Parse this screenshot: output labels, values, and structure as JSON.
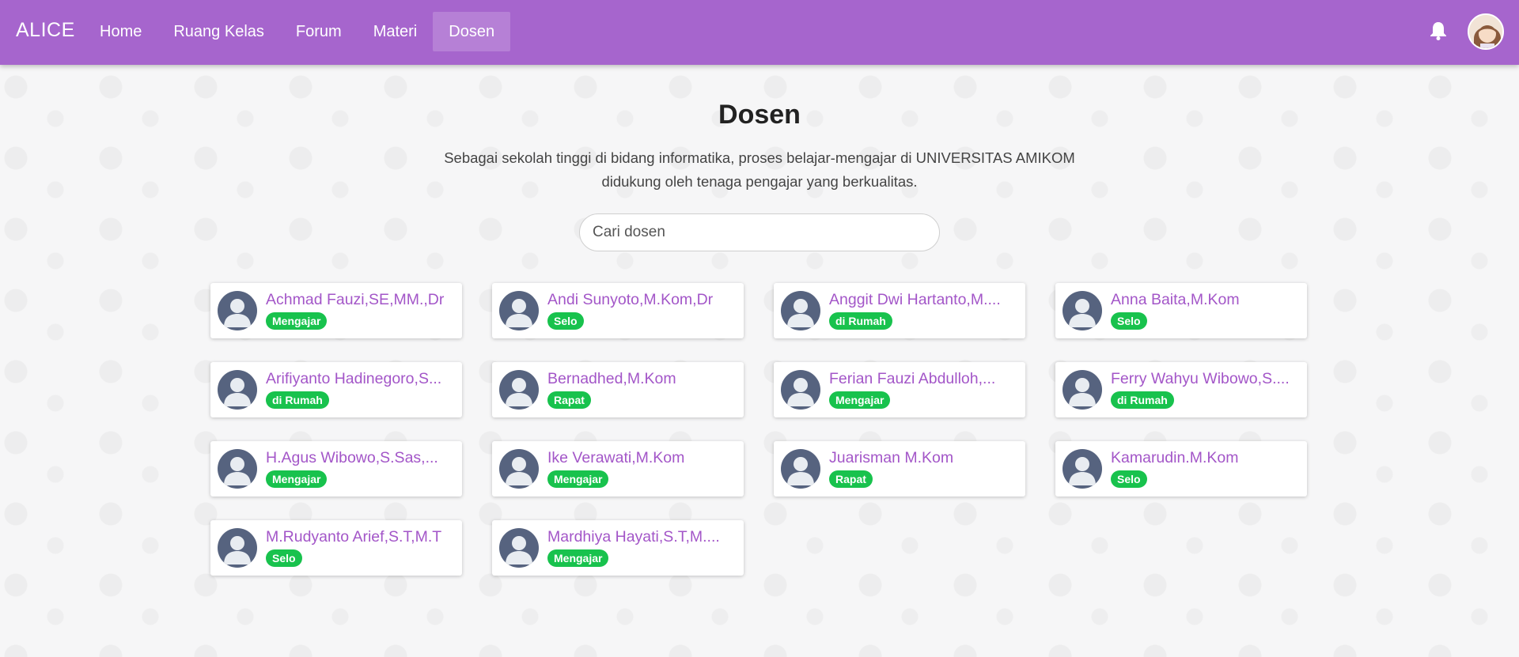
{
  "nav": {
    "brand": "ALICE",
    "items": [
      {
        "label": "Home"
      },
      {
        "label": "Ruang Kelas"
      },
      {
        "label": "Forum"
      },
      {
        "label": "Materi"
      },
      {
        "label": "Dosen",
        "active": true
      }
    ],
    "notification_icon": "bell-icon",
    "avatar": "user-avatar"
  },
  "page": {
    "title": "Dosen",
    "subtitle": "Sebagai sekolah tinggi di bidang informatika, proses belajar-mengajar di UNIVERSITAS AMIKOM didukung oleh tenaga pengajar yang berkualitas."
  },
  "search": {
    "placeholder": "Cari dosen",
    "value": ""
  },
  "lecturers": [
    {
      "name": "Achmad Fauzi,SE,MM.,Dr",
      "status": "Mengajar"
    },
    {
      "name": "Andi Sunyoto,M.Kom,Dr",
      "status": "Selo"
    },
    {
      "name": "Anggit Dwi Hartanto,M....",
      "status": "di Rumah"
    },
    {
      "name": "Anna Baita,M.Kom",
      "status": "Selo"
    },
    {
      "name": "Arifiyanto Hadinegoro,S...",
      "status": "di Rumah"
    },
    {
      "name": "Bernadhed,M.Kom",
      "status": "Rapat"
    },
    {
      "name": "Ferian Fauzi Abdulloh,...",
      "status": "Mengajar"
    },
    {
      "name": "Ferry Wahyu Wibowo,S....",
      "status": "di Rumah"
    },
    {
      "name": "H.Agus Wibowo,S.Sas,...",
      "status": "Mengajar"
    },
    {
      "name": "Ike Verawati,M.Kom",
      "status": "Mengajar"
    },
    {
      "name": "Juarisman M.Kom",
      "status": "Rapat"
    },
    {
      "name": "Kamarudin.M.Kom",
      "status": "Selo"
    },
    {
      "name": "M.Rudyanto Arief,S.T,M.T",
      "status": "Selo"
    },
    {
      "name": "Mardhiya Hayati,S.T,M....",
      "status": "Mengajar"
    }
  ],
  "colors": {
    "navbar": "#a665cd",
    "name": "#a356c8",
    "badge": "#18c24d",
    "avatar_placeholder": "#56637f"
  }
}
